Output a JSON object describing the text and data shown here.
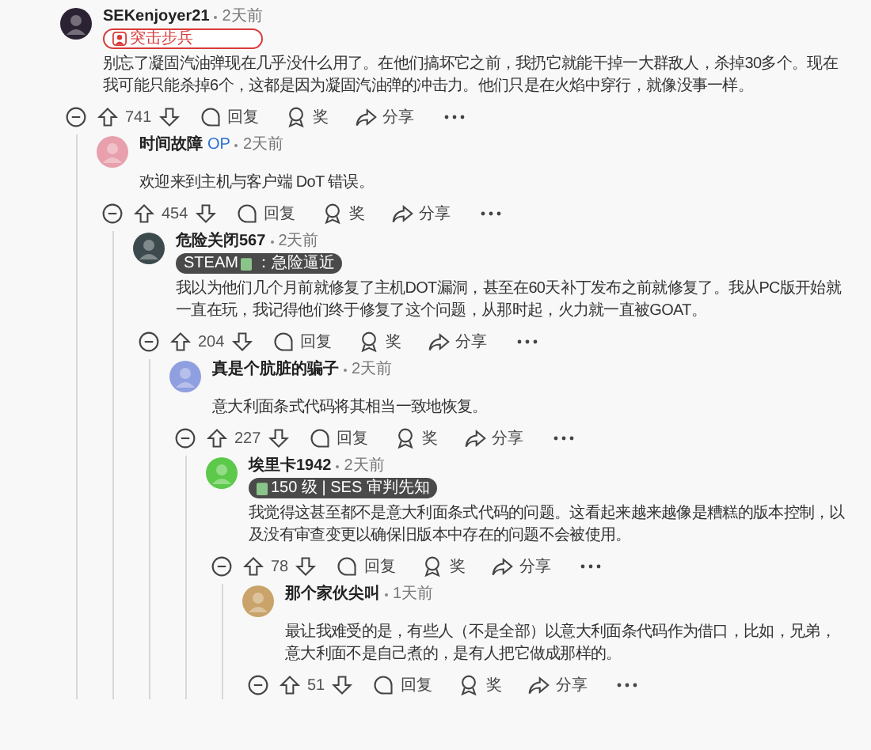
{
  "comments": [
    {
      "author": "SEKenjoyer21",
      "time": "2天前",
      "badge": {
        "kind": "outline",
        "text": "突击步兵"
      },
      "text": "别忘了凝固汽油弹现在几乎没什么用了。在他们搞坏它之前，我扔它就能干掉一大群敌人，杀掉30多个。现在我可能只能杀掉6个，这都是因为凝固汽油弹的冲击力。他们只是在火焰中穿行，就像没事一样。",
      "votes": "741",
      "reply": "回复",
      "award": "奖",
      "share": "分享",
      "children": [
        {
          "author": "时间故障",
          "op_label": "OP",
          "time": "2天前",
          "text": "欢迎来到主机与客户端 DoT 错误。",
          "votes": "454",
          "reply": "回复",
          "award": "奖",
          "share": "分享",
          "children": [
            {
              "author": "危险关闭567",
              "time": "2天前",
              "badge": {
                "kind": "dark",
                "prefix": "STEAM",
                "text": "：急险逼近"
              },
              "text": "我以为他们几个月前就修复了主机DOT漏洞，甚至在60天补丁发布之前就修复了。我从PC版开始就一直在玩，我记得他们终于修复了这个问题，从那时起，火力就一直被GOAT。",
              "votes": "204",
              "reply": "回复",
              "award": "奖",
              "share": "分享",
              "children": [
                {
                  "author": "真是个肮脏的骗子",
                  "time": "2天前",
                  "text": "意大利面条式代码将其相当一致地恢复。",
                  "votes": "227",
                  "reply": "回复",
                  "award": "奖",
                  "share": "分享",
                  "children": [
                    {
                      "author": "埃里卡1942",
                      "time": "2天前",
                      "badge": {
                        "kind": "dark",
                        "text": "150 级 | SES 审判先知"
                      },
                      "text": "我觉得这甚至都不是意大利面条式代码的问题。这看起来越来越像是糟糕的版本控制，以及没有审查变更以确保旧版本中存在的问题不会被使用。",
                      "votes": "78",
                      "reply": "回复",
                      "award": "奖",
                      "share": "分享",
                      "children": [
                        {
                          "author": "那个家伙尖叫",
                          "time": "1天前",
                          "text": "最让我难受的是，有些人（不是全部）以意大利面条代码作为借口，比如，兄弟，意大利面不是自己煮的，是有人把它做成那样的。",
                          "votes": "51",
                          "reply": "回复",
                          "award": "奖",
                          "share": "分享"
                        }
                      ]
                    }
                  ]
                }
              ]
            }
          ]
        }
      ]
    }
  ]
}
